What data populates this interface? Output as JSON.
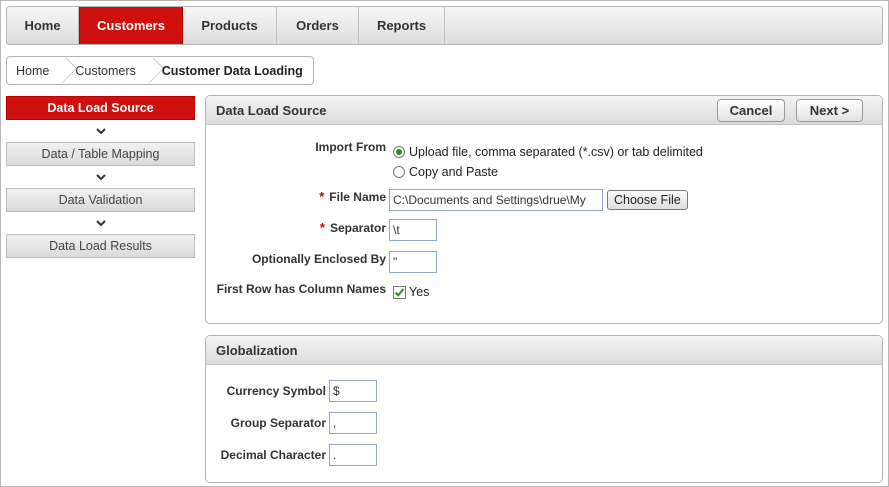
{
  "topnav": {
    "tabs": [
      {
        "label": "Home",
        "active": false
      },
      {
        "label": "Customers",
        "active": true
      },
      {
        "label": "Products",
        "active": false
      },
      {
        "label": "Orders",
        "active": false
      },
      {
        "label": "Reports",
        "active": false
      }
    ]
  },
  "breadcrumb": {
    "items": [
      "Home",
      "Customers"
    ],
    "current": "Customer Data Loading"
  },
  "wizard": {
    "steps": [
      {
        "label": "Data Load Source",
        "active": true
      },
      {
        "label": "Data / Table Mapping",
        "active": false
      },
      {
        "label": "Data Validation",
        "active": false
      },
      {
        "label": "Data Load Results",
        "active": false
      }
    ]
  },
  "source_panel": {
    "title": "Data Load Source",
    "cancel_label": "Cancel",
    "next_label": "Next >",
    "import_from": {
      "label": "Import From",
      "options": [
        "Upload file, comma separated (*.csv) or tab delimited",
        "Copy and Paste"
      ],
      "selected_index": 0
    },
    "file_name": {
      "label": "File Name",
      "value": "C:\\Documents and Settings\\drue\\My",
      "button": "Choose File",
      "required_mark": "*"
    },
    "separator": {
      "label": "Separator",
      "value": "\\t",
      "required_mark": "*"
    },
    "enclosed_by": {
      "label": "Optionally Enclosed By",
      "value": "\""
    },
    "first_row": {
      "label": "First Row has Column Names",
      "checked": true,
      "option": "Yes"
    }
  },
  "glob_panel": {
    "title": "Globalization",
    "currency": {
      "label": "Currency Symbol",
      "value": "$"
    },
    "group_sep": {
      "label": "Group Separator",
      "value": ","
    },
    "decimal": {
      "label": "Decimal Character",
      "value": "."
    }
  },
  "colors": {
    "accent": "#d00f0f",
    "check": "#2a8a2a"
  }
}
